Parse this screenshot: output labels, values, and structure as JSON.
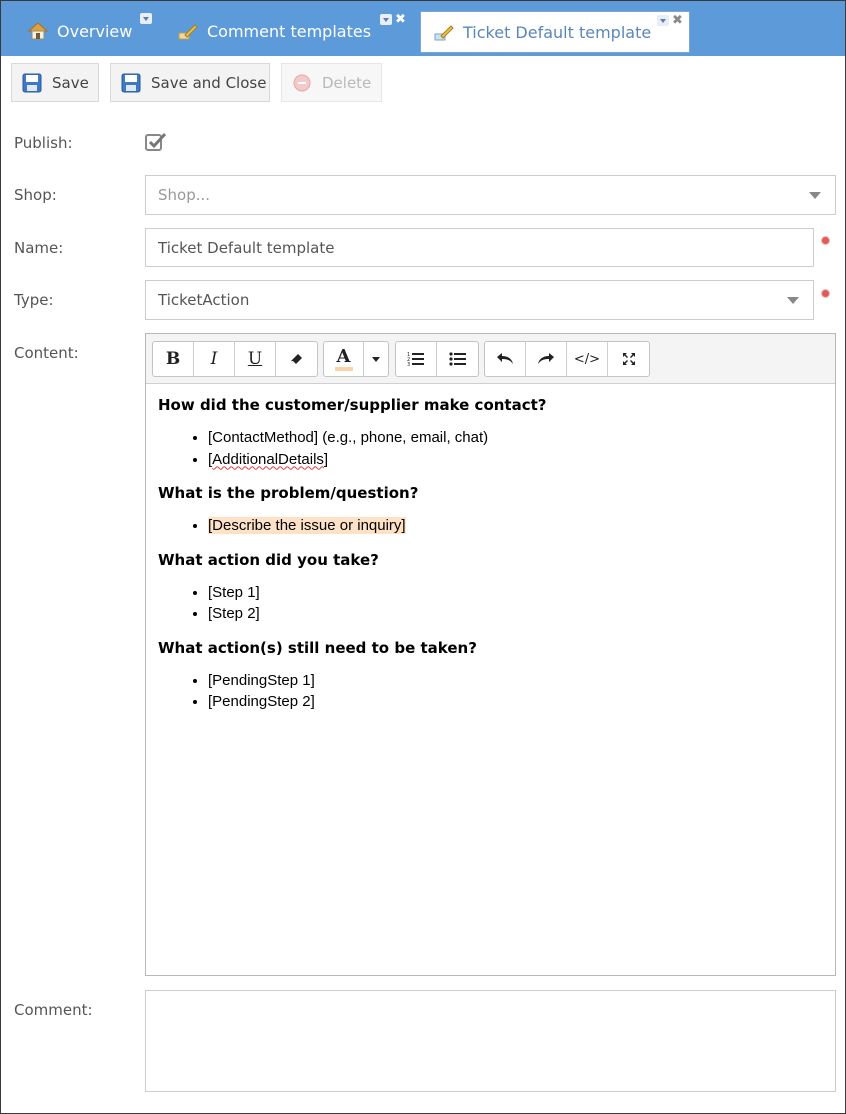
{
  "tabs": [
    {
      "label": "Overview",
      "icon": "home-icon"
    },
    {
      "label": "Comment templates",
      "icon": "edit-icon"
    },
    {
      "label": "Ticket Default template",
      "icon": "edit-icon",
      "active": true
    }
  ],
  "toolbar": {
    "save_label": "Save",
    "save_close_label": "Save and Close",
    "delete_label": "Delete"
  },
  "form": {
    "publish_label": "Publish:",
    "publish_checked": true,
    "shop_label": "Shop:",
    "shop_placeholder": "Shop...",
    "name_label": "Name:",
    "name_value": "Ticket Default template",
    "type_label": "Type:",
    "type_value": "TicketAction",
    "content_label": "Content:",
    "comment_label": "Comment:"
  },
  "editor": {
    "toolbar_buttons": [
      "B",
      "I",
      "U",
      "A",
      "</>"
    ],
    "sections": [
      {
        "heading": "How did the customer/supplier make contact?",
        "items": [
          "[ContactMethod] (e.g., phone, email, chat)",
          "[AdditionalDetails]"
        ]
      },
      {
        "heading": "What is the problem/question?",
        "items": [
          "[Describe the issue or inquiry]"
        ]
      },
      {
        "heading": "What action did you take?",
        "items": [
          "[Step 1]",
          "[Step 2]"
        ]
      },
      {
        "heading": "What action(s) still need to be taken?",
        "items": [
          "[PendingStep 1]",
          "[PendingStep 2]"
        ]
      }
    ]
  },
  "colors": {
    "tabbar": "#5c9ad9",
    "required": "#e05a5a",
    "highlight": "#fde2c8"
  }
}
